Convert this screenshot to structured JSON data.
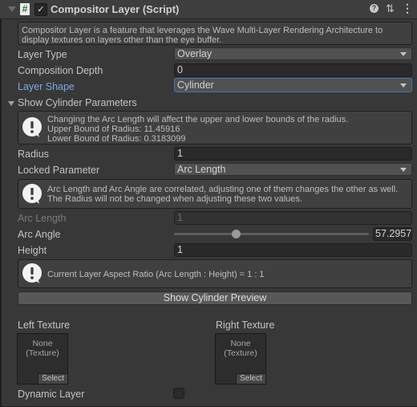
{
  "header": {
    "title": "Compositor Layer (Script)",
    "enabled": true,
    "icons": [
      "foldout-arrow-icon",
      "script-hash-icon",
      "enable-checkbox",
      "help-icon",
      "presets-icon",
      "kebab-menu-icon"
    ]
  },
  "description": "Compositor Layer is a feature that leverages the Wave Multi-Layer Rendering Architecture to display textures on layers other than the eye buffer.",
  "fields": {
    "layer_type": {
      "label": "Layer Type",
      "value": "Overlay"
    },
    "composition_depth": {
      "label": "Composition Depth",
      "value": "0"
    },
    "layer_shape": {
      "label": "Layer Shape",
      "value": "Cylinder"
    }
  },
  "cylinder": {
    "foldout_label": "Show Cylinder Parameters",
    "radius_help": {
      "line1": "Changing the Arc Length will affect the upper and lower bounds of the radius.",
      "line2": "Upper Bound of Radius: 11.45916",
      "line3": "Lower Bound of Radius: 0.3183099"
    },
    "radius": {
      "label": "Radius",
      "value": "1"
    },
    "locked_parameter": {
      "label": "Locked Parameter",
      "value": "Arc Length"
    },
    "correlation_help": {
      "line1": "Arc Length and Arc Angle are correlated, adjusting one of them changes the other as well.",
      "line2": "The Radius will not be changed when adjusting these two values."
    },
    "arc_length": {
      "label": "Arc Length",
      "value": "1"
    },
    "arc_angle": {
      "label": "Arc Angle",
      "value": "57.2957",
      "slider_fraction": 0.32
    },
    "height": {
      "label": "Height",
      "value": "1"
    },
    "aspect_help": "Current Layer Aspect Ratio (Arc Length : Height) = 1 : 1",
    "preview_button": "Show Cylinder Preview"
  },
  "textures": {
    "left": {
      "label": "Left Texture",
      "none_line1": "None",
      "none_line2": "(Texture)",
      "select": "Select"
    },
    "right": {
      "label": "Right Texture",
      "none_line1": "None",
      "none_line2": "(Texture)",
      "select": "Select"
    }
  },
  "dynamic_layer": {
    "label": "Dynamic Layer",
    "checked": false
  }
}
